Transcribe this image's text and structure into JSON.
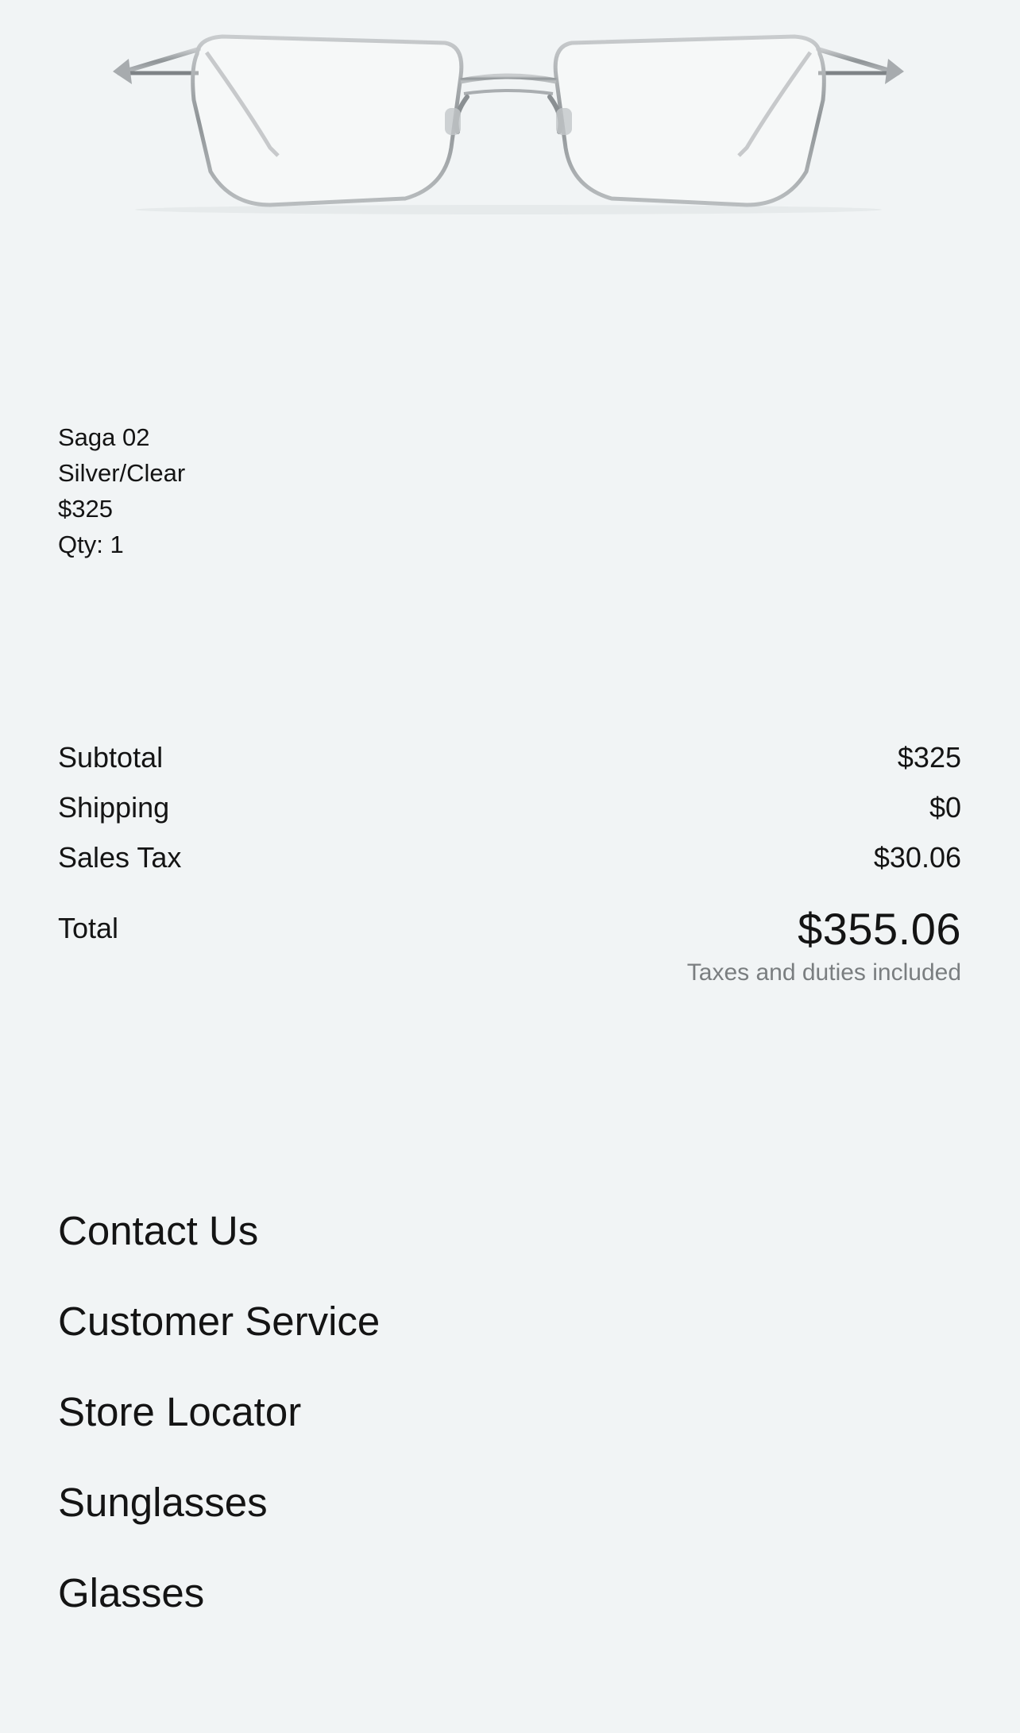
{
  "product": {
    "name": "Saga 02",
    "color": "Silver/Clear",
    "price": "$325",
    "quantity": "Qty: 1"
  },
  "summary": {
    "subtotal_label": "Subtotal",
    "subtotal_value": "$325",
    "shipping_label": "Shipping",
    "shipping_value": "$0",
    "tax_label": "Sales Tax",
    "tax_value": "$30.06",
    "total_label": "Total",
    "total_value": "$355.06",
    "tax_note": "Taxes and duties included"
  },
  "footer": {
    "links": [
      "Contact Us",
      "Customer Service",
      "Store Locator",
      "Sunglasses",
      "Glasses"
    ]
  },
  "colors": {
    "background": "#f1f4f5",
    "text": "#141414",
    "muted": "#7a7e80",
    "frame_silver": "#9ea3a6"
  }
}
